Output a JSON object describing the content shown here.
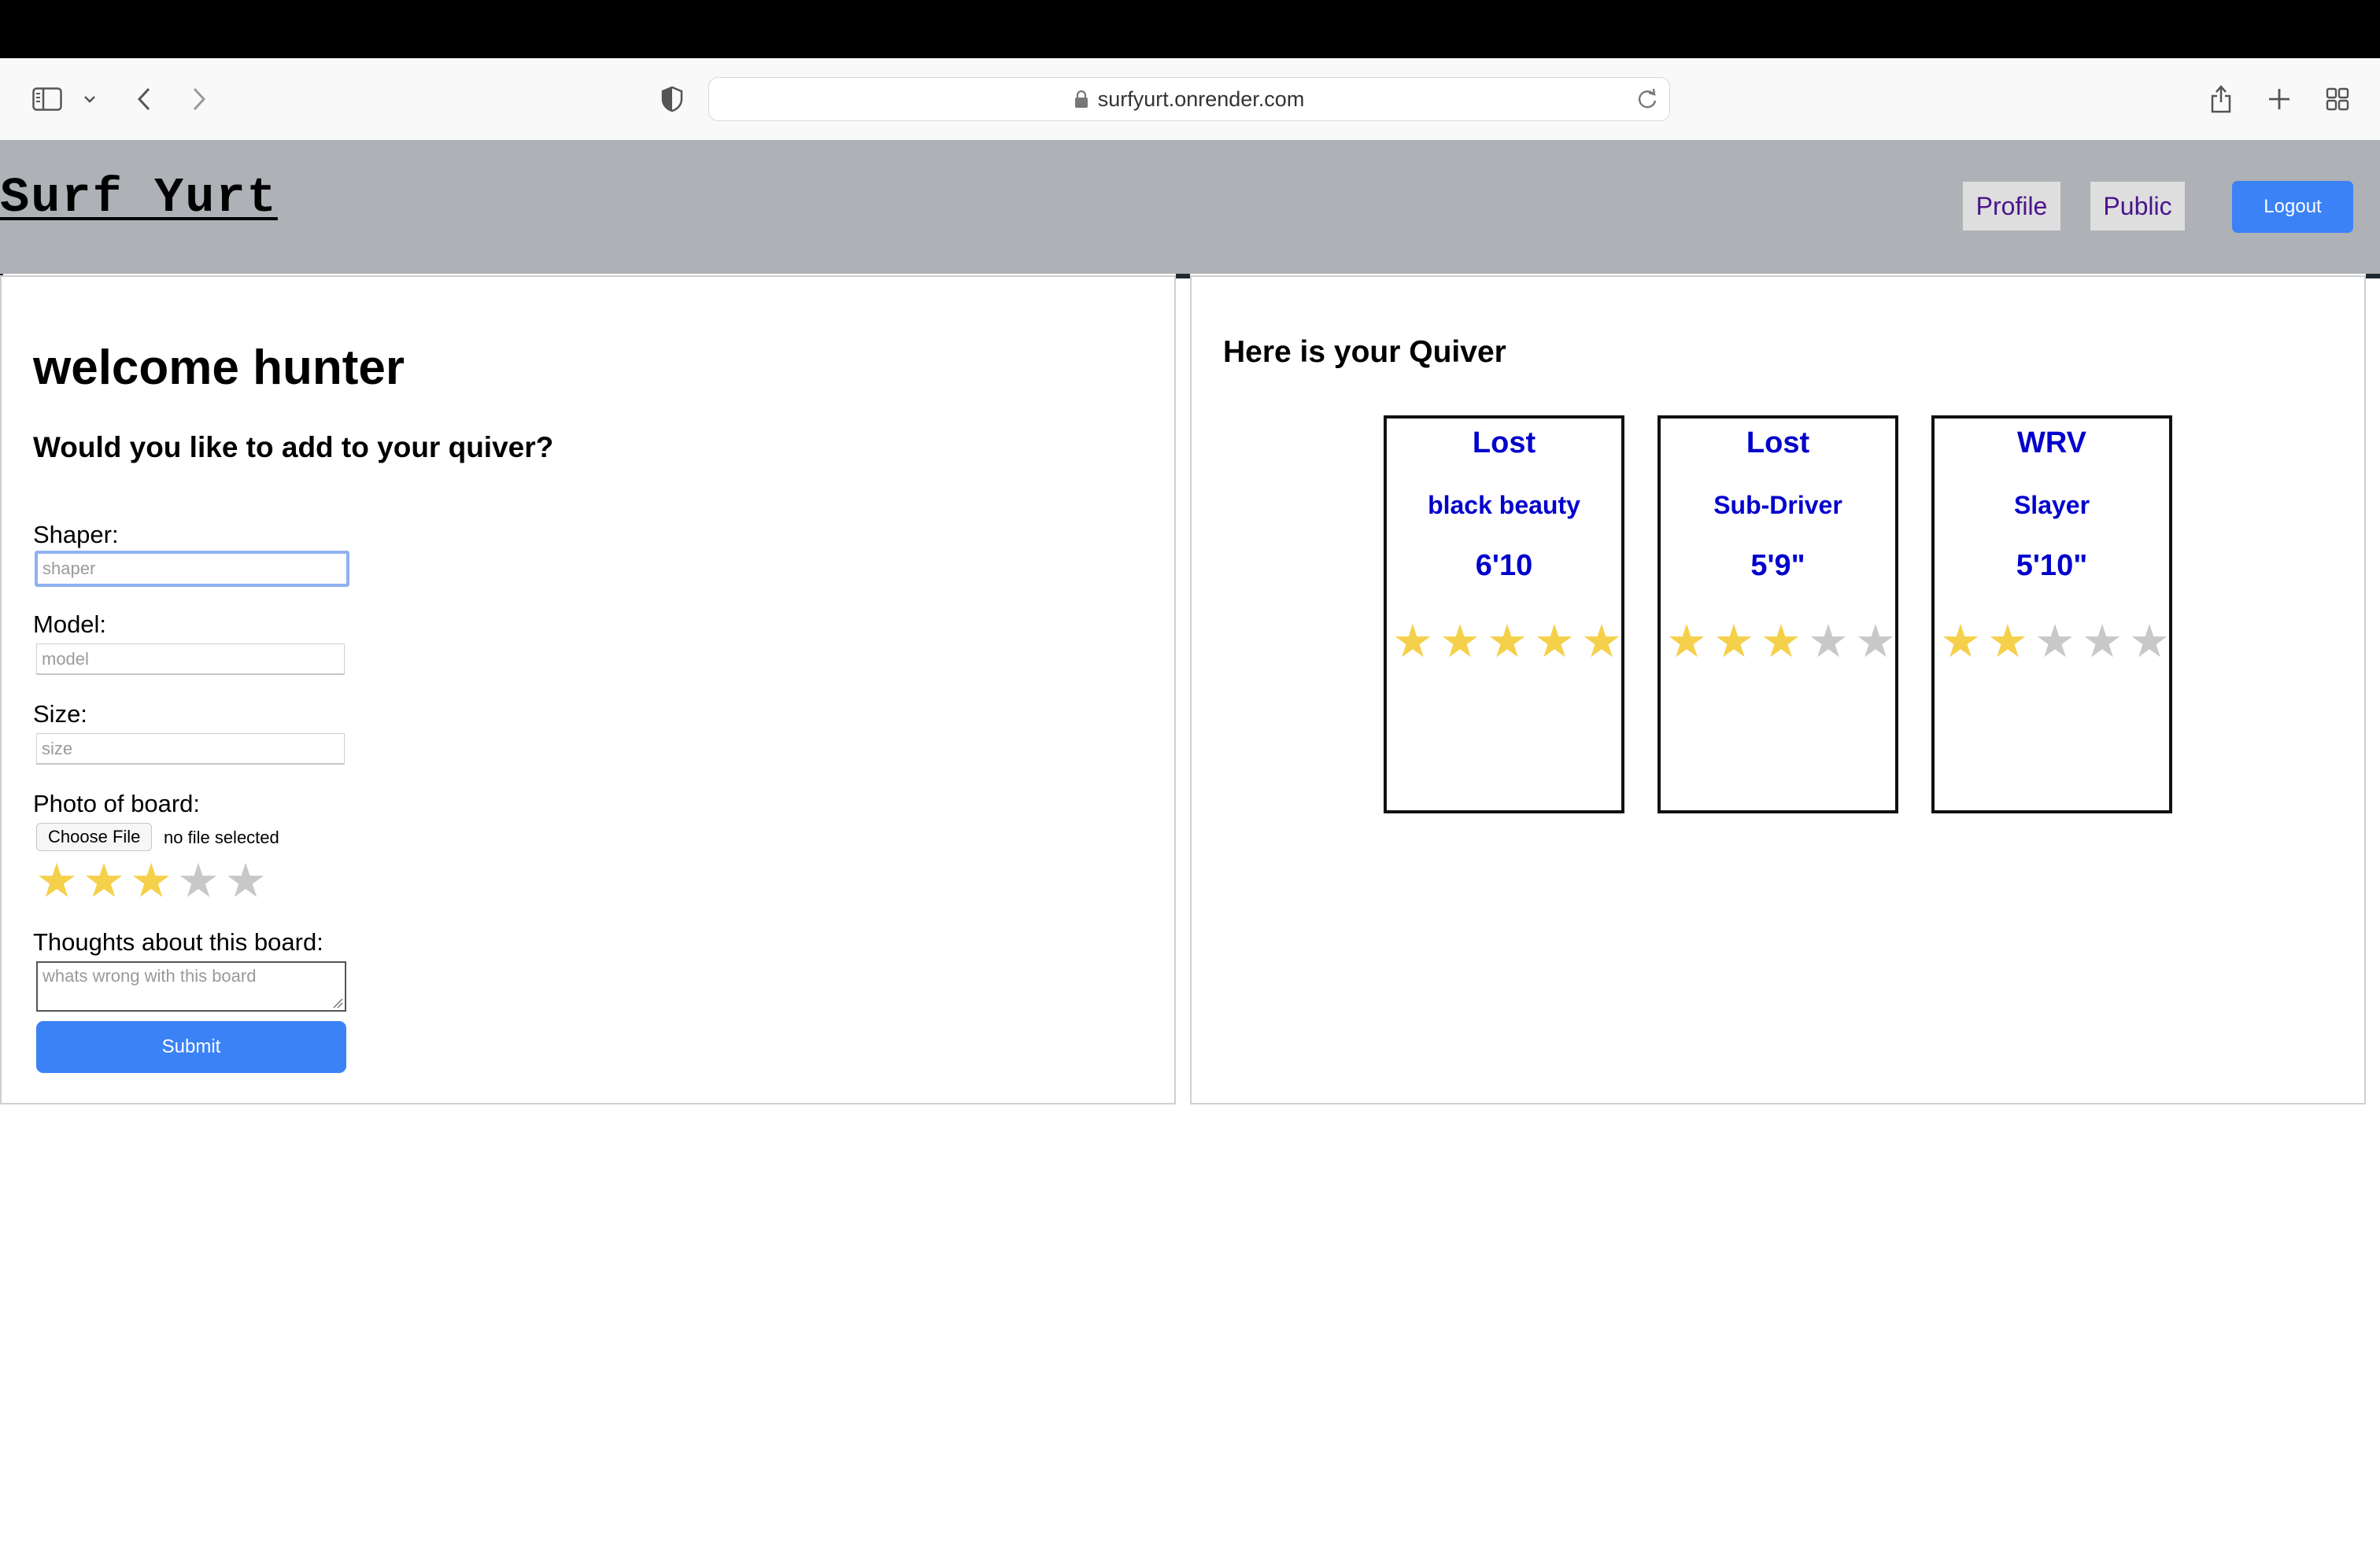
{
  "browser": {
    "url": "surfyurt.onrender.com"
  },
  "header": {
    "logo": "Surf Yurt",
    "nav": [
      {
        "label": "Profile"
      },
      {
        "label": "Public"
      }
    ],
    "logout_label": "Logout"
  },
  "form": {
    "welcome": "welcome hunter",
    "question": "Would you like to add to your quiver?",
    "shaper_label": "Shaper:",
    "shaper_placeholder": "shaper",
    "model_label": "Model:",
    "model_placeholder": "model",
    "size_label": "Size:",
    "size_placeholder": "size",
    "photo_label": "Photo of board:",
    "choose_file_label": "Choose File",
    "no_file_text": "no file selected",
    "rating": 3,
    "rating_max": 5,
    "thoughts_label": "Thoughts about this board:",
    "thoughts_placeholder": "whats wrong with this board",
    "submit_label": "Submit"
  },
  "quiver": {
    "title": "Here is your Quiver",
    "boards": [
      {
        "shaper": "Lost",
        "model": "black beauty",
        "size": "6'10",
        "rating": 5
      },
      {
        "shaper": "Lost",
        "model": "Sub-Driver",
        "size": "5'9\"",
        "rating": 3
      },
      {
        "shaper": "WRV",
        "model": "Slayer",
        "size": "5'10\"",
        "rating": 2
      }
    ]
  },
  "colors": {
    "header_bg": "#aeb1b6",
    "accent_blue": "#3b82f6",
    "star_on": "#f5d04a",
    "star_off": "#c8c8c8",
    "board_text": "#0000cc",
    "nav_text": "#4a148c"
  }
}
